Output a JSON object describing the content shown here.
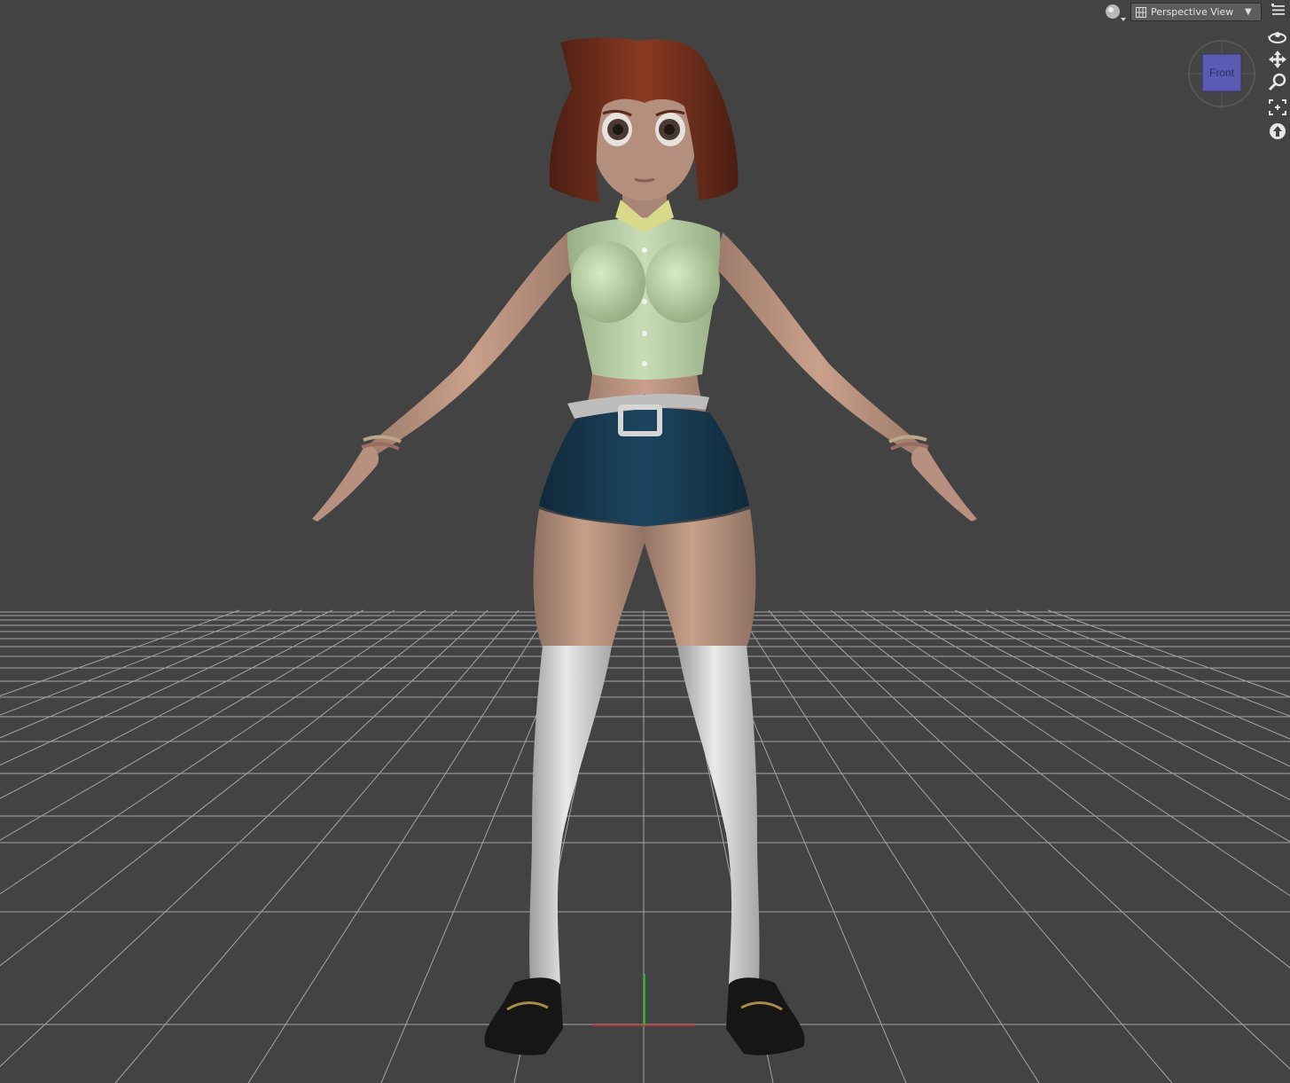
{
  "viewport": {
    "view_selector": {
      "label": "Perspective View"
    },
    "nav_cube": {
      "face_label": "Front"
    },
    "nav_tools": [
      "orbit",
      "pan",
      "zoom",
      "frame",
      "home"
    ],
    "colors": {
      "background": "#434343",
      "grid": "#b5b5b5",
      "nav_cube_face": "#5b5bb3",
      "x_axis": "#b33a3a",
      "y_axis": "#2fae2f"
    }
  }
}
